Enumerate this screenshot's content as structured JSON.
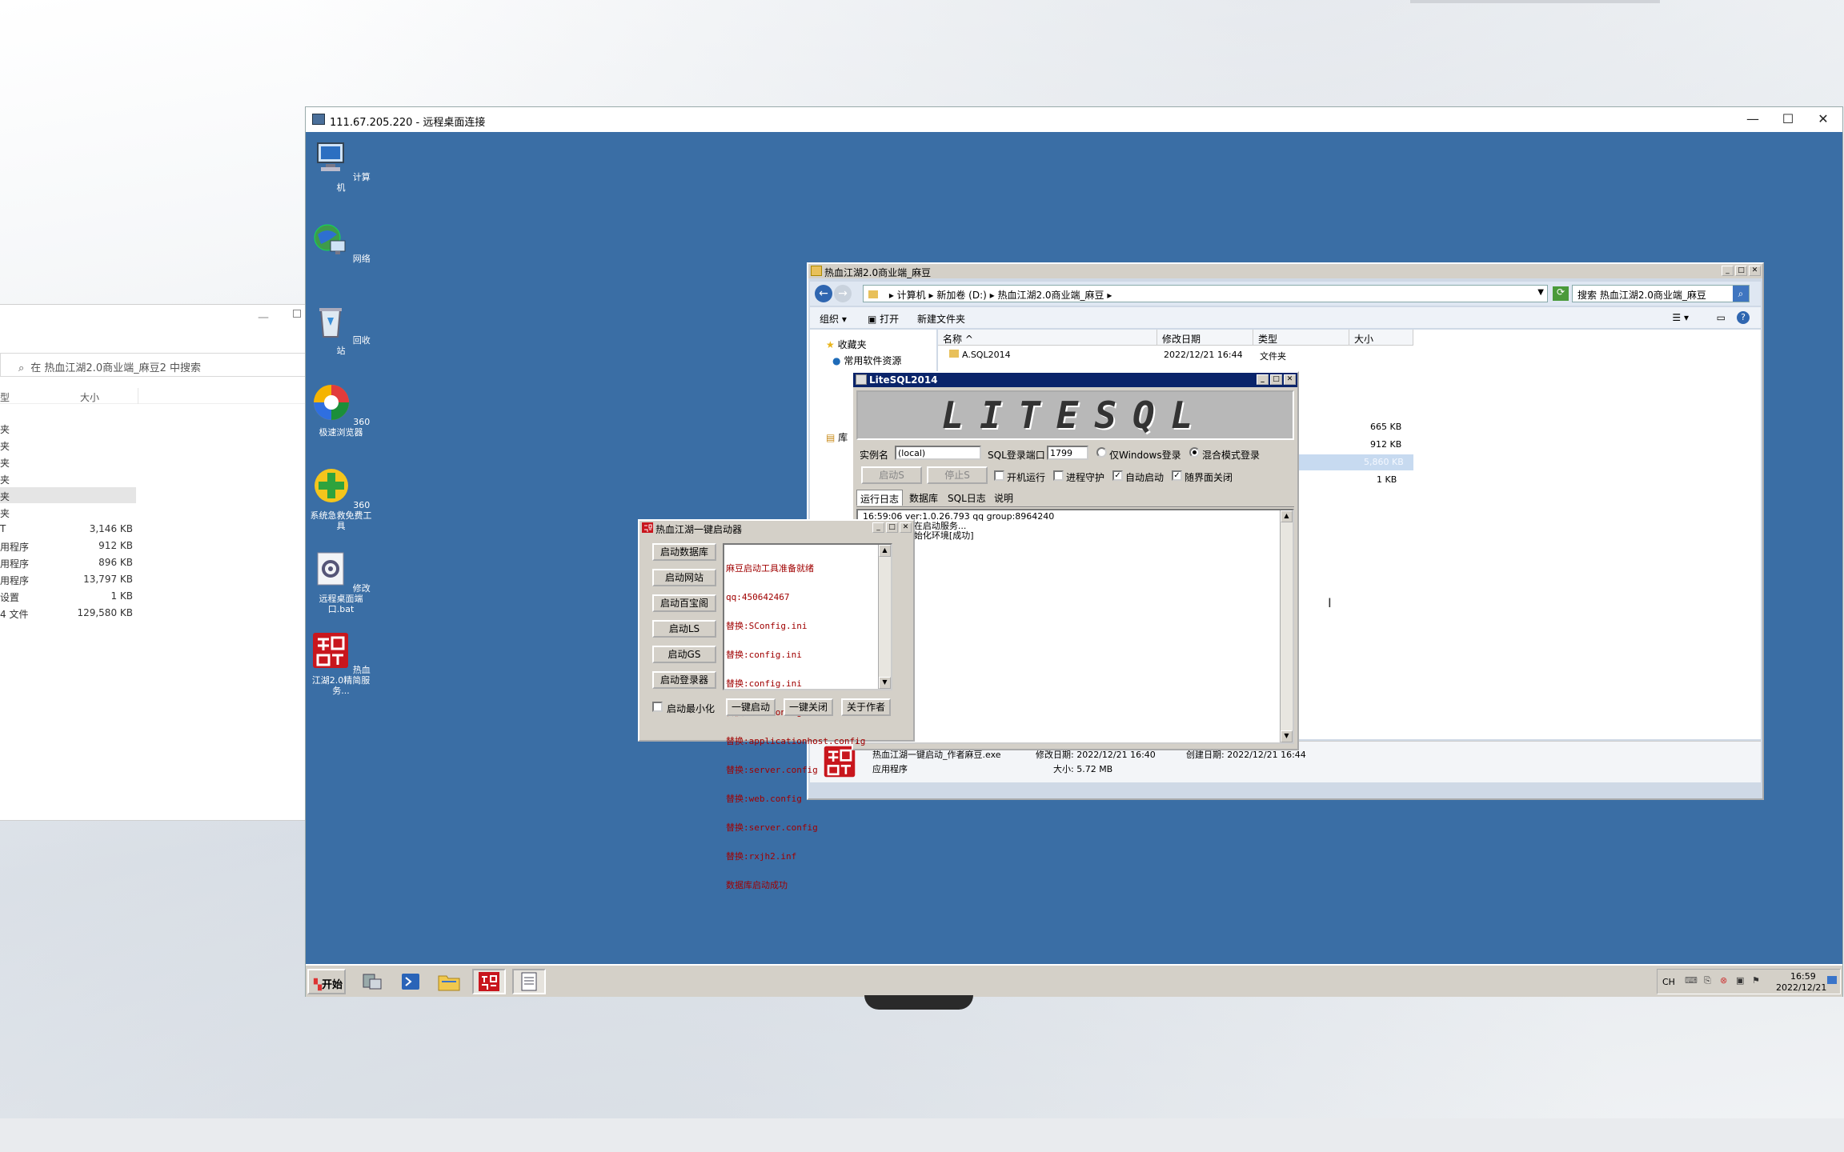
{
  "local_explorer": {
    "search_placeholder": "在 热血江湖2.0商业端_麻豆2 中搜索",
    "col_type": "型",
    "col_size": "大小",
    "rows": [
      {
        "type": "夹",
        "size": ""
      },
      {
        "type": "夹",
        "size": ""
      },
      {
        "type": "夹",
        "size": ""
      },
      {
        "type": "夹",
        "size": ""
      },
      {
        "type": "夹",
        "size": ""
      },
      {
        "type": "夹",
        "size": ""
      },
      {
        "type": "T",
        "size": "3,146 KB"
      },
      {
        "type": "用程序",
        "size": "912 KB"
      },
      {
        "type": "用程序",
        "size": "896 KB"
      },
      {
        "type": "用程序",
        "size": "13,797 KB"
      },
      {
        "type": "设置",
        "size": "1 KB"
      },
      {
        "type": "4 文件",
        "size": "129,580 KB"
      }
    ]
  },
  "rdp": {
    "title": "111.67.205.220 - 远程桌面连接",
    "min_glyph": "—",
    "max_glyph": "☐",
    "close_glyph": "✕"
  },
  "desktop_icons": [
    {
      "label": "计算机"
    },
    {
      "label": "网络"
    },
    {
      "label": "回收站"
    },
    {
      "label": "360极速浏览器"
    },
    {
      "label": "360系统急救免费工具"
    },
    {
      "label": "修改远程桌面端口.bat"
    },
    {
      "label": "热血江湖2.0精简服务..."
    }
  ],
  "explorer": {
    "title": "热血江湖2.0商业端_麻豆",
    "breadcrumb": [
      "计算机",
      "新加卷 (D:)",
      "热血江湖2.0商业端_麻豆"
    ],
    "search_placeholder": "搜索 热血江湖2.0商业端_麻豆",
    "toolbar": {
      "organize": "组织",
      "open": "打开",
      "new_folder": "新建文件夹"
    },
    "nav": {
      "favorites": "收藏夹",
      "common": "常用软件资源",
      "lib_char": "库"
    },
    "columns": {
      "name": "名称",
      "date": "修改日期",
      "type": "类型",
      "size": "大小"
    },
    "first_row": {
      "name": "A.SQL2014",
      "date": "2022/12/21 16:44",
      "type": "文件夹"
    },
    "sizes": [
      "665 KB",
      "912 KB",
      "5,860 KB",
      "1 KB"
    ],
    "status": {
      "filename": "热血江湖一键启动_作者麻豆.exe",
      "modified": "修改日期: 2022/12/21 16:40",
      "created": "创建日期: 2022/12/21 16:44",
      "type": "应用程序",
      "size": "大小: 5.72 MB"
    }
  },
  "litesql": {
    "title": "LiteSQL2014",
    "banner": "LITESQL",
    "instance_label": "实例名",
    "instance_value": "(local)",
    "port_label": "SQL登录端口",
    "port_value": "1799",
    "radio_win": "仅Windows登录",
    "radio_mixed": "混合模式登录",
    "btn_start": "启动S",
    "btn_stop": "停止S",
    "cb_boot": "开机运行",
    "cb_guard": "进程守护",
    "cb_autostart": "自动启动",
    "cb_close": "随界面关闭",
    "tabs": [
      "运行日志",
      "数据库",
      "SQL日志",
      "说明"
    ],
    "log": [
      "16:59:06 ver:1.0.26.793 qq group:8964240",
      "16:59:06 正在启动服务...",
      "16:59:06 初始化环境[成功]"
    ]
  },
  "launcher": {
    "title": "热血江湖一键启动器",
    "buttons": [
      "启动数据库",
      "启动网站",
      "启动百宝阁",
      "启动LS",
      "启动GS",
      "启动登录器"
    ],
    "log": [
      "麻豆启动工具准备就绪",
      "qq:450642467",
      "替换:SConfig.ini",
      "替换:config.ini",
      "替换:config.ini",
      "替换:Web.Config",
      "替换:applicationhost.config",
      "替换:server.config",
      "替换:web.config",
      "替换:server.config",
      "替换:rxjh2.inf",
      "数据库启动成功"
    ],
    "minimize_label": "启动最小化",
    "one_click_start": "一键启动",
    "one_click_close": "一键关闭",
    "about": "关于作者"
  },
  "taskbar": {
    "start": "开始",
    "lang": "CH",
    "time": "16:59",
    "date": "2022/12/21"
  }
}
